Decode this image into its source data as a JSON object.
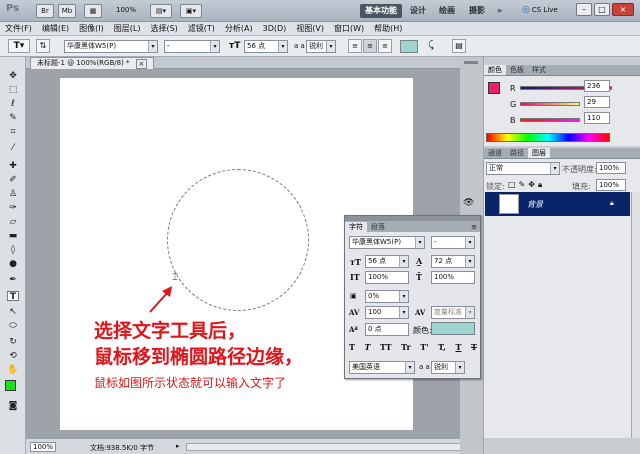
{
  "app": {
    "logo": "Ps",
    "buttons": [
      "Br",
      "Mb"
    ],
    "zoom": "100%",
    "workspaces": [
      "基本功能",
      "设计",
      "绘画",
      "摄影"
    ],
    "more": "»",
    "cslive": "CS Live",
    "window_controls": [
      "–",
      "□",
      "×"
    ]
  },
  "menu": [
    "文件(F)",
    "编辑(E)",
    "图像(I)",
    "图层(L)",
    "选择(S)",
    "滤镜(T)",
    "分析(A)",
    "3D(D)",
    "视图(V)",
    "窗口(W)",
    "帮助(H)"
  ],
  "options": {
    "tool_icon": "T",
    "font_family": "华康黑体W5(P)",
    "font_style": "-",
    "size": "56 点",
    "aa_label": "a a",
    "aa_mode": "锐利",
    "swatch_color": "#9ed5d0"
  },
  "document": {
    "tab_title": "未标题-1 @ 100%(RGB/8) *",
    "zoom": "100%",
    "status": "文档:938.5K/0 字节"
  },
  "annotation": {
    "line1": "选择文字工具后，",
    "line2": "鼠标移到椭圆路径边缘，",
    "line3": "鼠标如图所示状态就可以输入文字了",
    "color": "#e0141a"
  },
  "color_panel": {
    "tabs": [
      "颜色",
      "色板",
      "样式"
    ],
    "r_label": "R",
    "r_value": "236",
    "g_label": "G",
    "g_value": "29",
    "b_label": "B",
    "b_value": "110",
    "foreground": "#ec1d6e"
  },
  "layers_panel": {
    "tabs": [
      "通道",
      "路径",
      "图层"
    ],
    "blend_mode": "正常",
    "opacity_label": "不透明度:",
    "opacity_value": "100%",
    "lock_label": "锁定:",
    "fill_label": "填充:",
    "fill_value": "100%",
    "layer_name": "背景"
  },
  "character_panel": {
    "tabs": [
      "字符",
      "段落"
    ],
    "font_family": "华康黑体W5(P)",
    "font_style": "-",
    "size": "56 点",
    "leading": "72 点",
    "vscale": "100%",
    "hscale": "100%",
    "tracking_kern": "0%",
    "tracking": "100",
    "kerning": "度量标准",
    "baseline": "0 点",
    "color_label": "颜色:",
    "color": "#9ed5d0",
    "style_buttons": [
      "T",
      "T",
      "TT",
      "Tr",
      "T'",
      "T,",
      "T",
      "T"
    ],
    "language": "美国英语",
    "aa_label": "a a",
    "aa_mode": "锐利"
  }
}
